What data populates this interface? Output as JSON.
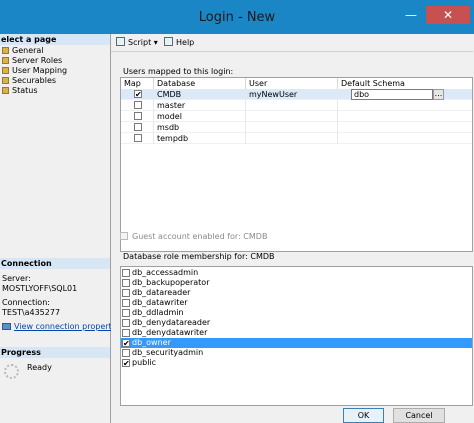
{
  "window": {
    "title": "Login - New",
    "minimize_glyph": "—",
    "close_glyph": "✕"
  },
  "left_panel": {
    "select_page_header": "elect a page",
    "pages": [
      {
        "label": "General",
        "icon": "page-icon"
      },
      {
        "label": "Server Roles",
        "icon": "page-icon"
      },
      {
        "label": "User Mapping",
        "icon": "page-icon"
      },
      {
        "label": "Securables",
        "icon": "page-icon"
      },
      {
        "label": "Status",
        "icon": "page-icon"
      }
    ],
    "connection_header": "Connection",
    "server_label": "Server:",
    "server_value": "MOSTLYOFF\\SQL01",
    "connection_label": "Connection:",
    "connection_value": "TEST\\a435277",
    "view_properties_link": "View connection properties",
    "progress_header": "Progress",
    "progress_status": "Ready"
  },
  "toolbar": {
    "script_label": "Script",
    "script_dropdown": "▾",
    "help_label": "Help"
  },
  "user_mapping": {
    "users_mapped_label": "Users mapped to this login:",
    "columns": [
      "Map",
      "Database",
      "User",
      "Default Schema"
    ],
    "rows": [
      {
        "map": true,
        "database": "CMDB",
        "user": "myNewUser",
        "schema": "dbo",
        "selected": true
      },
      {
        "map": false,
        "database": "master",
        "user": "",
        "schema": "",
        "selected": false
      },
      {
        "map": false,
        "database": "model",
        "user": "",
        "schema": "",
        "selected": false
      },
      {
        "map": false,
        "database": "msdb",
        "user": "",
        "schema": "",
        "selected": false
      },
      {
        "map": false,
        "database": "tempdb",
        "user": "",
        "schema": "",
        "selected": false
      }
    ],
    "ellipsis": "...",
    "guest_label": "Guest account enabled for: CMDB",
    "role_membership_label": "Database role membership for: CMDB",
    "roles": [
      {
        "name": "db_accessadmin",
        "checked": false,
        "selected": false
      },
      {
        "name": "db_backupoperator",
        "checked": false,
        "selected": false
      },
      {
        "name": "db_datareader",
        "checked": false,
        "selected": false
      },
      {
        "name": "db_datawriter",
        "checked": false,
        "selected": false
      },
      {
        "name": "db_ddladmin",
        "checked": false,
        "selected": false
      },
      {
        "name": "db_denydatareader",
        "checked": false,
        "selected": false
      },
      {
        "name": "db_denydatawriter",
        "checked": false,
        "selected": false
      },
      {
        "name": "db_owner",
        "checked": true,
        "selected": true
      },
      {
        "name": "db_securityadmin",
        "checked": false,
        "selected": false
      },
      {
        "name": "public",
        "checked": true,
        "selected": false
      }
    ]
  },
  "buttons": {
    "ok": "OK",
    "cancel": "Cancel"
  },
  "check_glyph": "✔",
  "colors": {
    "titlebar": "#1a86c6",
    "selection": "#3399ff",
    "close": "#c75050"
  }
}
